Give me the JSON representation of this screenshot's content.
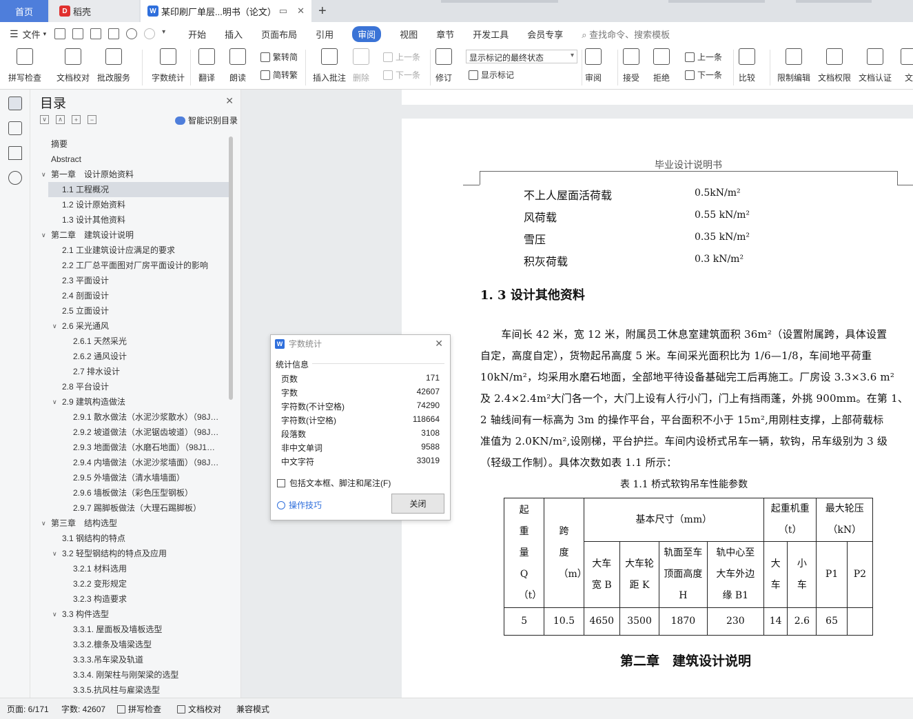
{
  "tabs": {
    "home": "首页",
    "wps": "稻壳",
    "doc": "某印刷厂单层...明书（论文）"
  },
  "menu": {
    "file": "文件",
    "items": [
      "开始",
      "插入",
      "页面布局",
      "引用",
      "审阅",
      "视图",
      "章节",
      "开发工具",
      "会员专享"
    ],
    "active": "审阅",
    "search": "查找命令、搜索模板"
  },
  "ribbon": {
    "spell": "拼写检查",
    "doccheck": "文档校对",
    "batch": "批改服务",
    "wordcount": "字数统计",
    "translate": "翻译",
    "read": "朗读",
    "t2s": "繁转简",
    "s2t": "简转繁",
    "insert_comment": "插入批注",
    "delete": "删除",
    "prev_comment": "上一条",
    "next_comment": "下一条",
    "revise": "修订",
    "markup_state": "显示标记的最终状态",
    "show_markup": "显示标记",
    "review": "审阅",
    "accept": "接受",
    "reject": "拒绝",
    "prev": "上一条",
    "next": "下一条",
    "compare": "比较",
    "restrict": "限制编辑",
    "rights": "文档权限",
    "certify": "文档认证",
    "cut": "文"
  },
  "toc": {
    "title": "目录",
    "smart": "智能识别目录",
    "items": [
      {
        "label": "摘要",
        "level": 0,
        "arrow": ""
      },
      {
        "label": "Abstract",
        "level": 0,
        "arrow": ""
      },
      {
        "label": "第一章　设计原始资料",
        "level": 0,
        "arrow": "v"
      },
      {
        "label": "1.1 工程概况",
        "level": 1,
        "arrow": "",
        "selected": true
      },
      {
        "label": "1.2 设计原始资料",
        "level": 1,
        "arrow": ""
      },
      {
        "label": "1.3 设计其他资料",
        "level": 1,
        "arrow": ""
      },
      {
        "label": "第二章　建筑设计说明",
        "level": 0,
        "arrow": "v"
      },
      {
        "label": "2.1 工业建筑设计应满足的要求",
        "level": 1,
        "arrow": ""
      },
      {
        "label": "2.2 工厂总平面图对厂房平面设计的影响",
        "level": 1,
        "arrow": ""
      },
      {
        "label": "2.3 平面设计",
        "level": 1,
        "arrow": ""
      },
      {
        "label": "2.4 剖面设计",
        "level": 1,
        "arrow": ""
      },
      {
        "label": "2.5 立面设计",
        "level": 1,
        "arrow": ""
      },
      {
        "label": "2.6 采光通风",
        "level": 1,
        "arrow": "v"
      },
      {
        "label": "2.6.1 天然采光",
        "level": 2,
        "arrow": ""
      },
      {
        "label": "2.6.2 通风设计",
        "level": 2,
        "arrow": ""
      },
      {
        "label": "2.7 排水设计",
        "level": 2,
        "arrow": ""
      },
      {
        "label": "2.8 平台设计",
        "level": 1,
        "arrow": ""
      },
      {
        "label": "2.9 建筑构造做法",
        "level": 1,
        "arrow": "v"
      },
      {
        "label": "2.9.1 散水做法（水泥沙浆散水）（98J…",
        "level": 2,
        "arrow": ""
      },
      {
        "label": "2.9.2 坡道做法（水泥锯齿坡道）（98J…",
        "level": 2,
        "arrow": ""
      },
      {
        "label": "2.9.3 地面做法（水磨石地面）（98J1…",
        "level": 2,
        "arrow": ""
      },
      {
        "label": "2.9.4 内墙做法（水泥沙浆墙面）（98J…",
        "level": 2,
        "arrow": ""
      },
      {
        "label": "2.9.5 外墙做法（清水墙墙面）",
        "level": 2,
        "arrow": ""
      },
      {
        "label": "2.9.6 墙板做法（彩色压型钢板）",
        "level": 2,
        "arrow": ""
      },
      {
        "label": "2.9.7 踢脚板做法（大理石踢脚板）",
        "level": 2,
        "arrow": ""
      },
      {
        "label": "第三章　结构选型",
        "level": 0,
        "arrow": "v"
      },
      {
        "label": "3.1 钢结构的特点",
        "level": 1,
        "arrow": ""
      },
      {
        "label": "3.2 轻型钢结构的特点及应用",
        "level": 1,
        "arrow": "v"
      },
      {
        "label": "3.2.1 材料选用",
        "level": 2,
        "arrow": ""
      },
      {
        "label": "3.2.2 变形规定",
        "level": 2,
        "arrow": ""
      },
      {
        "label": "3.2.3 构造要求",
        "level": 2,
        "arrow": ""
      },
      {
        "label": "3.3 构件选型",
        "level": 1,
        "arrow": "v"
      },
      {
        "label": "3.3.1. 屋面板及墙板选型",
        "level": 2,
        "arrow": ""
      },
      {
        "label": "3.3.2.檩条及墙梁选型",
        "level": 2,
        "arrow": ""
      },
      {
        "label": "3.3.3.吊车梁及轨道",
        "level": 2,
        "arrow": ""
      },
      {
        "label": "3.3.4. 刚架柱与刚架梁的选型",
        "level": 2,
        "arrow": ""
      },
      {
        "label": "3.3.5.抗风柱与雇梁选型",
        "level": 2,
        "arrow": ""
      }
    ]
  },
  "doc": {
    "header": "毕业设计说明书",
    "loads": [
      {
        "name": "不上人屋面活荷载",
        "value": "0.5kN/m²"
      },
      {
        "name": "风荷载",
        "value": "0.55  kN/m²"
      },
      {
        "name": "雪压",
        "value": "0.35  kN/m²"
      },
      {
        "name": "积灰荷载",
        "value": "0.3  kN/m²"
      }
    ],
    "section_title": "1. 3 设计其他资料",
    "paragraph": [
      "　　车间长 42 米，宽 12 米，附属员工休息室建筑面积 36m²（设置附属跨，具体设置",
      "自定，高度自定），货物起吊高度 5 米。车间采光面积比为 1/6—1/8，车间地平荷重",
      "10kN/m²，均采用水磨石地面，全部地平待设备基础完工后再施工。厂房设 3.3×3.6 m²",
      "及 2.4×2.4m²大门各一个，大门上设有人行小门，门上有挡雨蓬，外挑 900mm。在第 1、",
      "2 轴线间有一标高为 3m 的操作平台，平台面积不小于 15m²,用刚柱支撑，上部荷载标",
      "准值为 2.0KN/m²,设刚梯，平台护拦。车间内设桥式吊车一辆，软钩，吊车级别为 3 级",
      "（轻级工作制）。具体次数如表 1.1 所示："
    ],
    "table_caption": "表 1.1 桥式软钩吊车性能参数",
    "table": {
      "h_q": "起重量Q（t）",
      "h_span": "跨度（m）",
      "h_basic": "基本尺寸（mm）",
      "h_weight": "起重机重（t）",
      "h_wheel": "最大轮压（kN）",
      "h_b": "大车宽 B",
      "h_k": "大车轮距 K",
      "h_h": "轨面至车顶面高度 H",
      "h_b1": "轨中心至大车外边缘 B1",
      "h_big": "大车",
      "h_small": "小车",
      "h_p1": "P1",
      "h_p2": "P2",
      "row": [
        "5",
        "10.5",
        "4650",
        "3500",
        "1870",
        "230",
        "14",
        "2.6",
        "65",
        ""
      ]
    },
    "chapter": "第二章　建筑设计说明"
  },
  "dialog": {
    "title": "字数统计",
    "section": "统计信息",
    "stats": [
      {
        "label": "页数",
        "value": "171"
      },
      {
        "label": "字数",
        "value": "42607"
      },
      {
        "label": "字符数(不计空格)",
        "value": "74290"
      },
      {
        "label": "字符数(计空格)",
        "value": "118664"
      },
      {
        "label": "段落数",
        "value": "3108"
      },
      {
        "label": "非中文单词",
        "value": "9588"
      },
      {
        "label": "中文字符",
        "value": "33019"
      }
    ],
    "checkbox": "包括文本框、脚注和尾注(F)",
    "tips": "操作技巧",
    "close": "关闭"
  },
  "status": {
    "page": "页面: 6/171",
    "words": "字数: 42607",
    "spell": "拼写检查",
    "check": "文档校对",
    "compat": "兼容模式"
  }
}
